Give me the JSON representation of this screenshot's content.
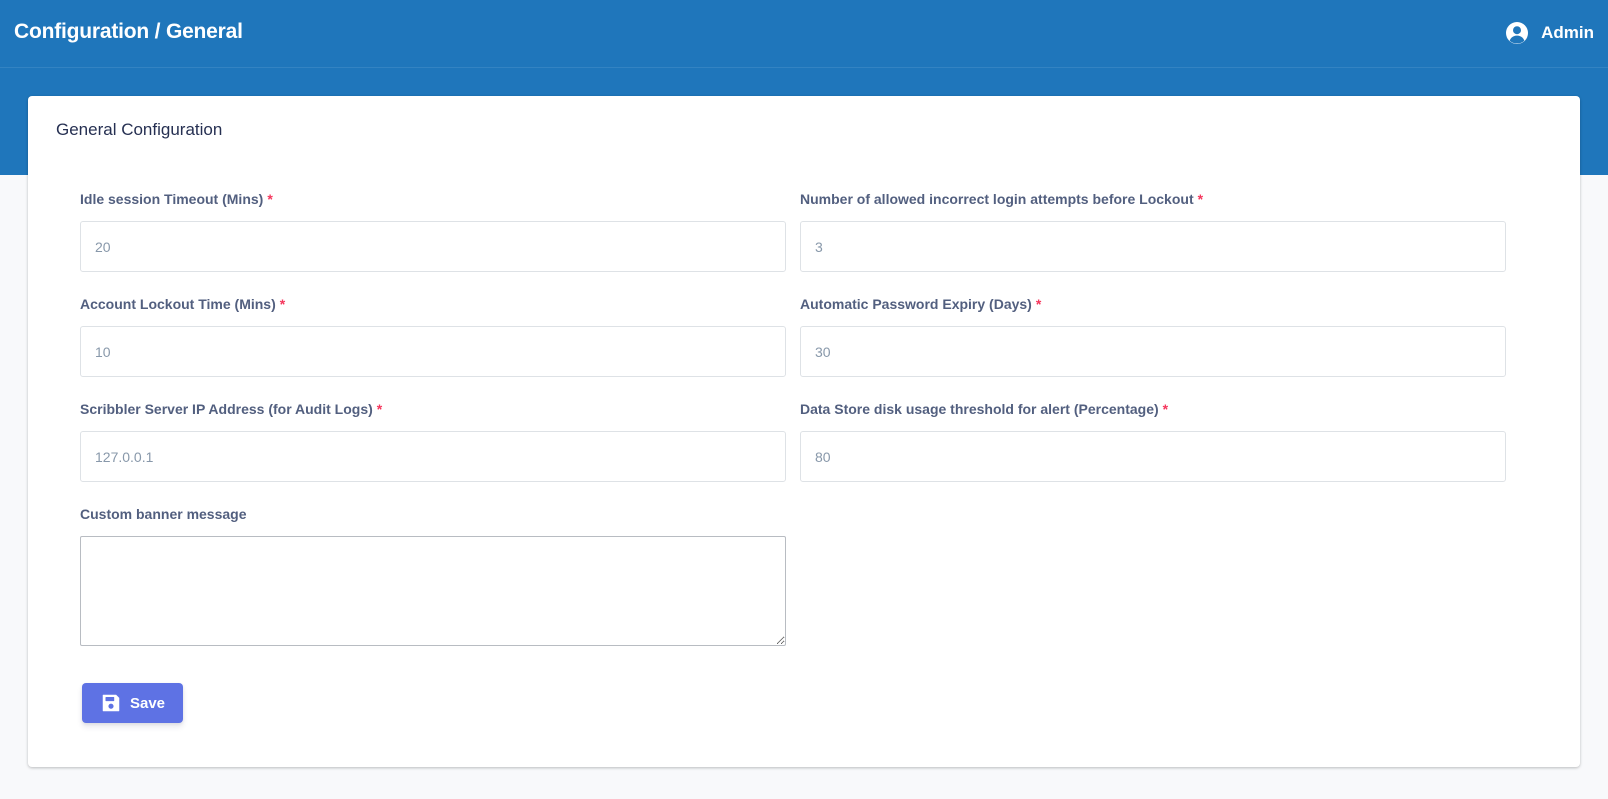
{
  "header": {
    "title": "Configuration / General",
    "user": {
      "name": "Admin",
      "icon": "user-circle-icon"
    },
    "color": "#1f76bb"
  },
  "card": {
    "title": "General Configuration"
  },
  "form": {
    "idle_timeout": {
      "label": "Idle session Timeout (Mins)",
      "required_mark": "*",
      "placeholder": "20",
      "value": ""
    },
    "login_attempts": {
      "label": "Number of allowed incorrect login attempts before Lockout",
      "required_mark": "*",
      "placeholder": "3",
      "value": ""
    },
    "lockout_time": {
      "label": "Account Lockout Time (Mins)",
      "required_mark": "*",
      "placeholder": "10",
      "value": ""
    },
    "password_expiry": {
      "label": "Automatic Password Expiry (Days)",
      "required_mark": "*",
      "placeholder": "30",
      "value": ""
    },
    "scribbler_ip": {
      "label": "Scribbler Server IP Address (for Audit Logs)",
      "required_mark": "*",
      "placeholder": "127.0.0.1",
      "value": ""
    },
    "disk_threshold": {
      "label": "Data Store disk usage threshold for alert (Percentage)",
      "required_mark": "*",
      "placeholder": "80",
      "value": ""
    },
    "banner_message": {
      "label": "Custom banner message",
      "value": ""
    }
  },
  "actions": {
    "save_label": "Save",
    "save_icon": "floppy-disk-icon",
    "save_color": "#5e72e4"
  },
  "colors": {
    "required": "#f5365c",
    "label": "#525f7f",
    "placeholder": "#8898aa"
  }
}
